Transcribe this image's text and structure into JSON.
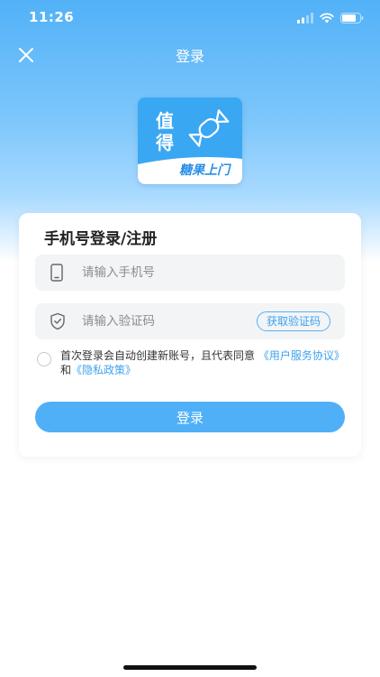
{
  "status": {
    "time": "11:26"
  },
  "nav": {
    "title": "登录",
    "close_icon": "close-icon"
  },
  "logo": {
    "char1": "值",
    "char2": "得",
    "slogan": "糖果上门",
    "icon": "candy-icon"
  },
  "card": {
    "title": "手机号登录/注册",
    "phone": {
      "placeholder": "请输入手机号",
      "value": "",
      "icon": "phone-icon"
    },
    "code": {
      "placeholder": "请输入验证码",
      "value": "",
      "icon": "shield-icon",
      "button": "获取验证码"
    },
    "agreement": {
      "text": "首次登录会自动创建新账号，且代表同意",
      "user_agreement": "《用户服务协议》",
      "and": "和",
      "privacy": "《隐私政策》"
    },
    "login_button": "登录"
  },
  "colors": {
    "accent": "#4fb0f7",
    "link": "#3ba2f0"
  }
}
